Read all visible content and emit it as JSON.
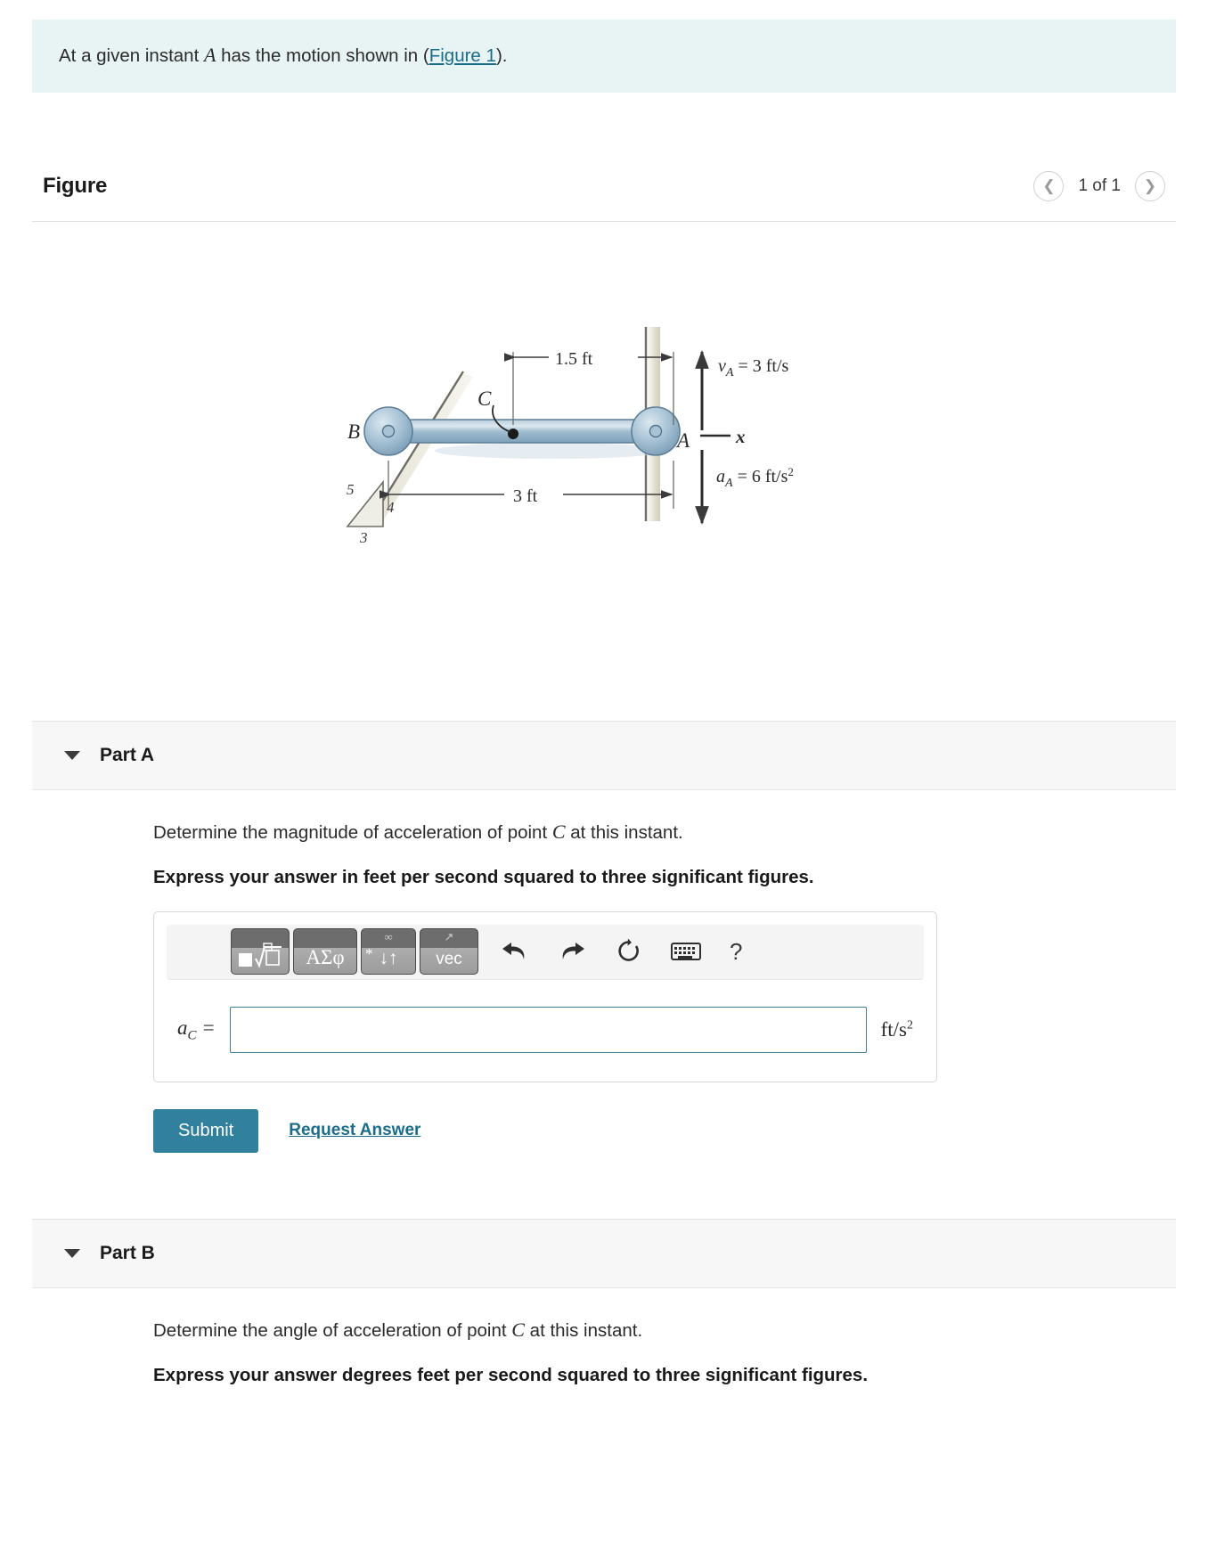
{
  "problem": {
    "text_before": "At a given instant ",
    "var_a": "A",
    "text_mid": " has the motion shown in (",
    "figure_link": "Figure 1",
    "text_after": ")."
  },
  "figure": {
    "title": "Figure",
    "count_label": "1 of 1",
    "prev_icon": "chevron-left-icon",
    "next_icon": "chevron-right-icon"
  },
  "diagram": {
    "label_b": "B",
    "label_a": "A",
    "label_c": "C",
    "label_x": "x",
    "dim_top": "1.5 ft",
    "dim_bottom": "3 ft",
    "velocity": "v_A = 3 ft/s",
    "velocity_sym": "v",
    "velocity_sub": "A",
    "velocity_val": "= 3 ft/s",
    "accel_sym": "a",
    "accel_sub": "A",
    "accel_val": "= 6 ft/s",
    "accel_exp": "2",
    "slope_5": "5",
    "slope_4": "4",
    "slope_3": "3"
  },
  "part_a": {
    "label": "Part A",
    "question_before": "Determine the magnitude of acceleration of point ",
    "question_var": "C",
    "question_after": " at this instant.",
    "instruction": "Express your answer in feet per second squared to three significant figures.",
    "answer_var": "a",
    "answer_sub": "C",
    "answer_eq": "=",
    "answer_value": "",
    "answer_placeholder": "",
    "units": "ft/s",
    "units_exp": "2",
    "submit_label": "Submit",
    "request_label": "Request Answer",
    "toolbar": {
      "template_label": "√",
      "template_icon": "square-root-template-icon",
      "greek_label": "ΑΣφ",
      "greek_icon": "greek-symbols-icon",
      "ops_label": "↓↑",
      "ops_top": "∞",
      "ops_star": "*",
      "ops_icon": "math-operators-icon",
      "vec_label": "vec",
      "vec_top": "↗",
      "vec_icon": "vector-icon",
      "undo_icon": "undo-arrow-icon",
      "redo_icon": "redo-arrow-icon",
      "reset_icon": "reset-circular-arrow-icon",
      "keyboard_icon": "keyboard-icon",
      "help_label": "?",
      "help_icon": "help-question-icon"
    }
  },
  "part_b": {
    "label": "Part B",
    "question_before": "Determine the angle of acceleration of point ",
    "question_var": "C",
    "question_after": " at this instant.",
    "instruction": "Express your answer degrees feet per second squared to three significant figures."
  },
  "colors": {
    "banner_bg": "#e8f4f4",
    "link": "#1a6b8a",
    "submit_bg": "#31809e",
    "input_border": "#3f7c96",
    "part_header_bg": "#f7f7f7",
    "rod_blue": "#8fb2c9"
  }
}
